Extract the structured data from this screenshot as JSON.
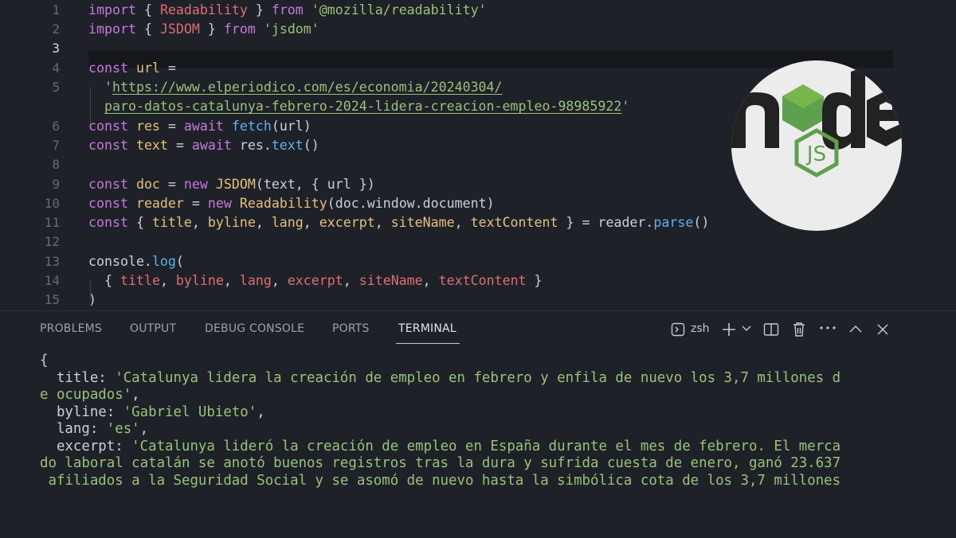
{
  "editor": {
    "line_numbers": [
      "1",
      "2",
      "3",
      "4",
      "5",
      "6",
      "7",
      "8",
      "9",
      "10",
      "11",
      "12",
      "13",
      "14",
      "15"
    ],
    "current_line": "3",
    "lines": [
      [
        {
          "t": "import",
          "c": "kw"
        },
        {
          "t": " { ",
          "c": "pl"
        },
        {
          "t": "Readability",
          "c": "vr"
        },
        {
          "t": " } ",
          "c": "pl"
        },
        {
          "t": "from",
          "c": "kw"
        },
        {
          "t": " ",
          "c": "pl"
        },
        {
          "t": "'@mozilla/readability'",
          "c": "str"
        }
      ],
      [
        {
          "t": "import",
          "c": "kw"
        },
        {
          "t": " { ",
          "c": "pl"
        },
        {
          "t": "JSDOM",
          "c": "vr"
        },
        {
          "t": " } ",
          "c": "pl"
        },
        {
          "t": "from",
          "c": "kw"
        },
        {
          "t": " ",
          "c": "pl"
        },
        {
          "t": "'jsdom'",
          "c": "str"
        }
      ],
      [],
      [
        {
          "t": "const",
          "c": "kw"
        },
        {
          "t": " ",
          "c": "pl"
        },
        {
          "t": "url",
          "c": "cls"
        },
        {
          "t": " =",
          "c": "pl"
        }
      ],
      [
        {
          "t": "'",
          "c": "str"
        },
        {
          "t": "https://www.elperiodico.com/es/economia/20240304/",
          "c": "str ul"
        }
      ],
      [
        {
          "t": "paro-datos-catalunya-febrero-2024-lidera-creacion-empleo-98985922",
          "c": "str ul"
        },
        {
          "t": "'",
          "c": "str"
        }
      ],
      [
        {
          "t": "const",
          "c": "kw"
        },
        {
          "t": " ",
          "c": "pl"
        },
        {
          "t": "res",
          "c": "cls"
        },
        {
          "t": " = ",
          "c": "pl"
        },
        {
          "t": "await",
          "c": "kw"
        },
        {
          "t": " ",
          "c": "pl"
        },
        {
          "t": "fetch",
          "c": "fn"
        },
        {
          "t": "(url)",
          "c": "pl"
        }
      ],
      [
        {
          "t": "const",
          "c": "kw"
        },
        {
          "t": " ",
          "c": "pl"
        },
        {
          "t": "text",
          "c": "cls"
        },
        {
          "t": " = ",
          "c": "pl"
        },
        {
          "t": "await",
          "c": "kw"
        },
        {
          "t": " res.",
          "c": "pl"
        },
        {
          "t": "text",
          "c": "fn"
        },
        {
          "t": "()",
          "c": "pl"
        }
      ],
      [],
      [
        {
          "t": "const",
          "c": "kw"
        },
        {
          "t": " ",
          "c": "pl"
        },
        {
          "t": "doc",
          "c": "cls"
        },
        {
          "t": " = ",
          "c": "pl"
        },
        {
          "t": "new",
          "c": "kw"
        },
        {
          "t": " ",
          "c": "pl"
        },
        {
          "t": "JSDOM",
          "c": "cls"
        },
        {
          "t": "(text, { url })",
          "c": "pl"
        }
      ],
      [
        {
          "t": "const",
          "c": "kw"
        },
        {
          "t": " ",
          "c": "pl"
        },
        {
          "t": "reader",
          "c": "cls"
        },
        {
          "t": " = ",
          "c": "pl"
        },
        {
          "t": "new",
          "c": "kw"
        },
        {
          "t": " ",
          "c": "pl"
        },
        {
          "t": "Readability",
          "c": "cls"
        },
        {
          "t": "(doc.window.document)",
          "c": "pl"
        }
      ],
      [
        {
          "t": "const",
          "c": "kw"
        },
        {
          "t": " { ",
          "c": "pl"
        },
        {
          "t": "title",
          "c": "cls"
        },
        {
          "t": ", ",
          "c": "pl"
        },
        {
          "t": "byline",
          "c": "cls"
        },
        {
          "t": ", ",
          "c": "pl"
        },
        {
          "t": "lang",
          "c": "cls"
        },
        {
          "t": ", ",
          "c": "pl"
        },
        {
          "t": "excerpt",
          "c": "cls"
        },
        {
          "t": ", ",
          "c": "pl"
        },
        {
          "t": "siteName",
          "c": "cls"
        },
        {
          "t": ", ",
          "c": "pl"
        },
        {
          "t": "textContent",
          "c": "cls"
        },
        {
          "t": " } = reader.",
          "c": "pl"
        },
        {
          "t": "parse",
          "c": "fn"
        },
        {
          "t": "()",
          "c": "pl"
        }
      ],
      [],
      [
        {
          "t": "console.",
          "c": "pl"
        },
        {
          "t": "log",
          "c": "fn"
        },
        {
          "t": "(",
          "c": "pl"
        }
      ],
      [
        {
          "t": "{ ",
          "c": "pl"
        },
        {
          "t": "title",
          "c": "vr"
        },
        {
          "t": ", ",
          "c": "pl"
        },
        {
          "t": "byline",
          "c": "vr"
        },
        {
          "t": ", ",
          "c": "pl"
        },
        {
          "t": "lang",
          "c": "vr"
        },
        {
          "t": ", ",
          "c": "pl"
        },
        {
          "t": "excerpt",
          "c": "vr"
        },
        {
          "t": ", ",
          "c": "pl"
        },
        {
          "t": "siteName",
          "c": "vr"
        },
        {
          "t": ", ",
          "c": "pl"
        },
        {
          "t": "textContent",
          "c": "vr"
        },
        {
          "t": " }",
          "c": "pl"
        }
      ],
      [
        {
          "t": ")",
          "c": "pl"
        }
      ]
    ]
  },
  "logo": {
    "name": "node.js-logo",
    "colors": {
      "dark": "#222222",
      "green": "#5fa04e",
      "light_green": "#8cc84b",
      "background": "#ececec"
    }
  },
  "panel": {
    "tabs": [
      {
        "label": "PROBLEMS",
        "active": false
      },
      {
        "label": "OUTPUT",
        "active": false
      },
      {
        "label": "DEBUG CONSOLE",
        "active": false
      },
      {
        "label": "PORTS",
        "active": false
      },
      {
        "label": "TERMINAL",
        "active": true
      }
    ],
    "shell_label": "zsh",
    "icons": [
      "terminal-icon",
      "plus-icon",
      "chevron-down-icon",
      "split-icon",
      "trash-icon",
      "more-icon",
      "chevron-up-icon",
      "close-icon"
    ]
  },
  "terminal": {
    "lines": [
      [
        {
          "t": "{",
          "c": ""
        }
      ],
      [
        {
          "t": "  title: ",
          "c": ""
        },
        {
          "t": "'Catalunya lidera la creación de empleo en febrero y enfila de nuevo los 3,7 millones d",
          "c": "tstr"
        }
      ],
      [
        {
          "t": "e ocupados'",
          "c": "tstr"
        },
        {
          "t": ",",
          "c": ""
        }
      ],
      [
        {
          "t": "  byline: ",
          "c": ""
        },
        {
          "t": "'Gabriel Ubieto'",
          "c": "tstr"
        },
        {
          "t": ",",
          "c": ""
        }
      ],
      [
        {
          "t": "  lang: ",
          "c": ""
        },
        {
          "t": "'es'",
          "c": "tstr"
        },
        {
          "t": ",",
          "c": ""
        }
      ],
      [
        {
          "t": "  excerpt: ",
          "c": ""
        },
        {
          "t": "'Catalunya lideró la creación de empleo en España durante el mes de febrero. El merca",
          "c": "tstr"
        }
      ],
      [
        {
          "t": "do laboral catalán se anotó buenos registros tras la dura y sufrida cuesta de enero, ganó 23.637",
          "c": "tstr"
        }
      ],
      [
        {
          "t": " afiliados a la Seguridad Social y se asomó de nuevo hasta la simbólica cota de los 3,7 millones",
          "c": "tstr"
        }
      ]
    ]
  }
}
